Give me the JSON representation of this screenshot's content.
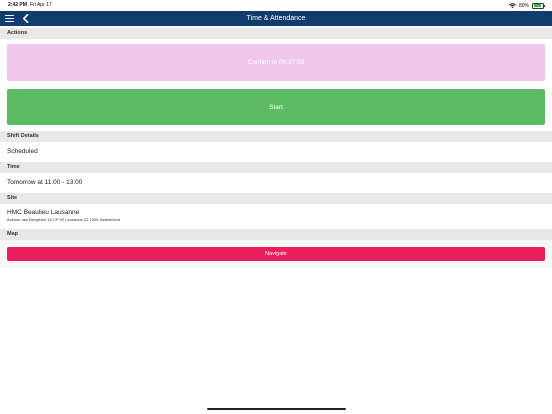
{
  "status_bar": {
    "time": "2:42 PM",
    "date": "Fri Apr 17",
    "battery": "80%",
    "battery_level": 0.8
  },
  "nav": {
    "title": "Time & Attendance"
  },
  "sections": {
    "actions": "Actions",
    "shift_details": "Shift Details",
    "time": "Time",
    "site": "Site",
    "map": "Map"
  },
  "actions": {
    "confirm_label": "Confirm in 06:17:55",
    "start_label": "Start"
  },
  "shift": {
    "status": "Scheduled"
  },
  "time": {
    "value": "Tomorrow at 11:00 - 13:00"
  },
  "site": {
    "name": "HMC Beaulieu Lausanne",
    "address": "Avenue des Bergières 10 CP 90 Lausanne 22 1000 Switzerland"
  },
  "map": {
    "navigate_label": "Navigate"
  },
  "colors": {
    "nav_bg": "#113c6e",
    "confirm_bg": "#f2c7ef",
    "start_bg": "#5dbb63",
    "navigate_bg": "#e91e5a",
    "section_bg": "#e8e8e8"
  }
}
